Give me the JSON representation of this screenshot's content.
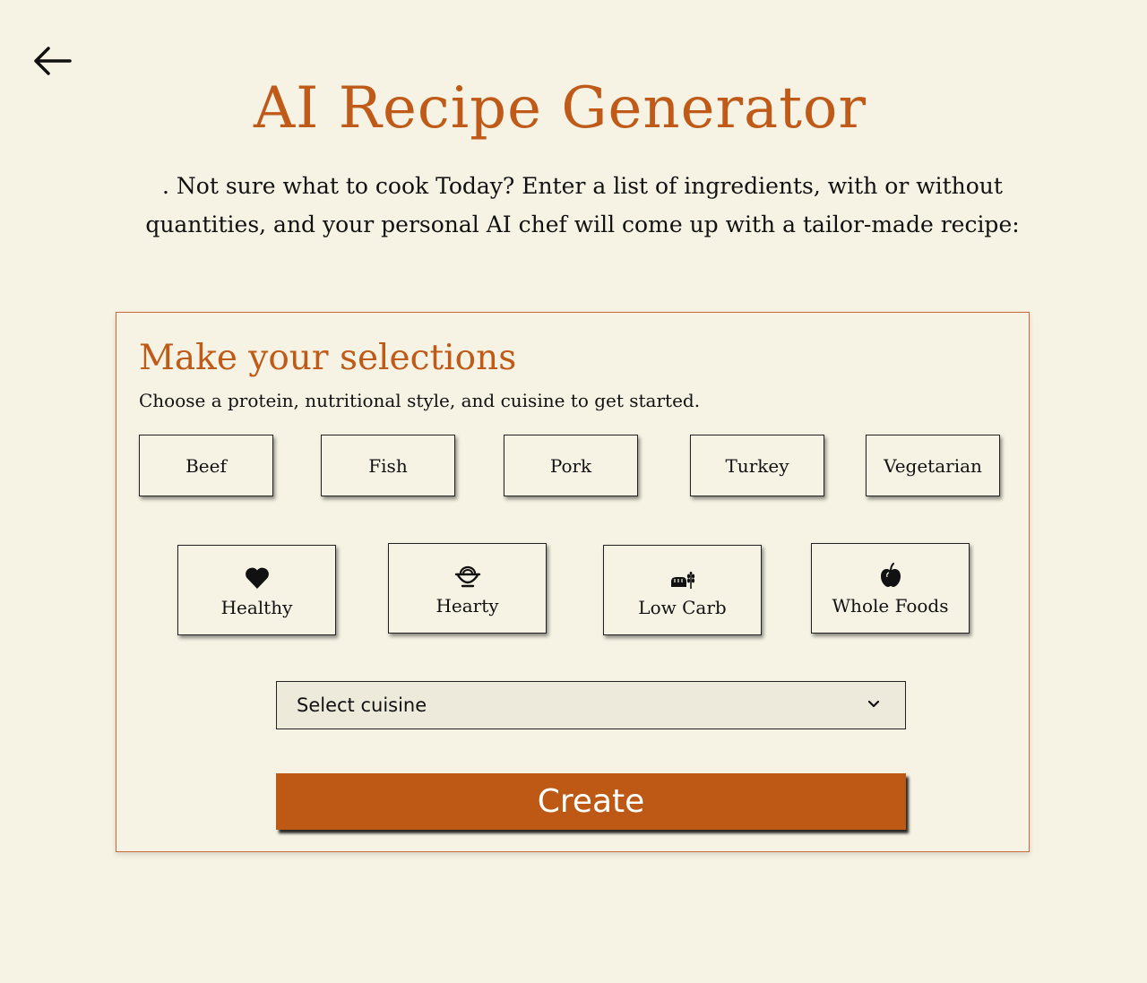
{
  "header": {
    "back_icon": "arrow-left-icon",
    "title": "AI Recipe Generator",
    "intro": ".   Not sure what to cook Today? Enter a list of ingredients, with or without quantities, and your personal AI chef will come up with a tailor-made recipe:"
  },
  "selections": {
    "title": "Make your selections",
    "subtitle": "Choose a protein, nutritional style, and cuisine to get started.",
    "proteins": [
      "Beef",
      "Fish",
      "Pork",
      "Turkey",
      "Vegetarian"
    ],
    "styles": [
      {
        "label": "Healthy",
        "icon": "heart-icon"
      },
      {
        "label": "Hearty",
        "icon": "bowl-icon"
      },
      {
        "label": "Low Carb",
        "icon": "bread-wheat-icon"
      },
      {
        "label": "Whole Foods",
        "icon": "apple-icon"
      }
    ],
    "cuisine_select": {
      "selected": "Select cuisine",
      "icon": "chevron-down-icon"
    },
    "create_label": "Create"
  },
  "colors": {
    "background": "#f6f3e4",
    "accent": "#bf5a18",
    "button": "#bd5915",
    "select_bg": "#edeadb"
  }
}
